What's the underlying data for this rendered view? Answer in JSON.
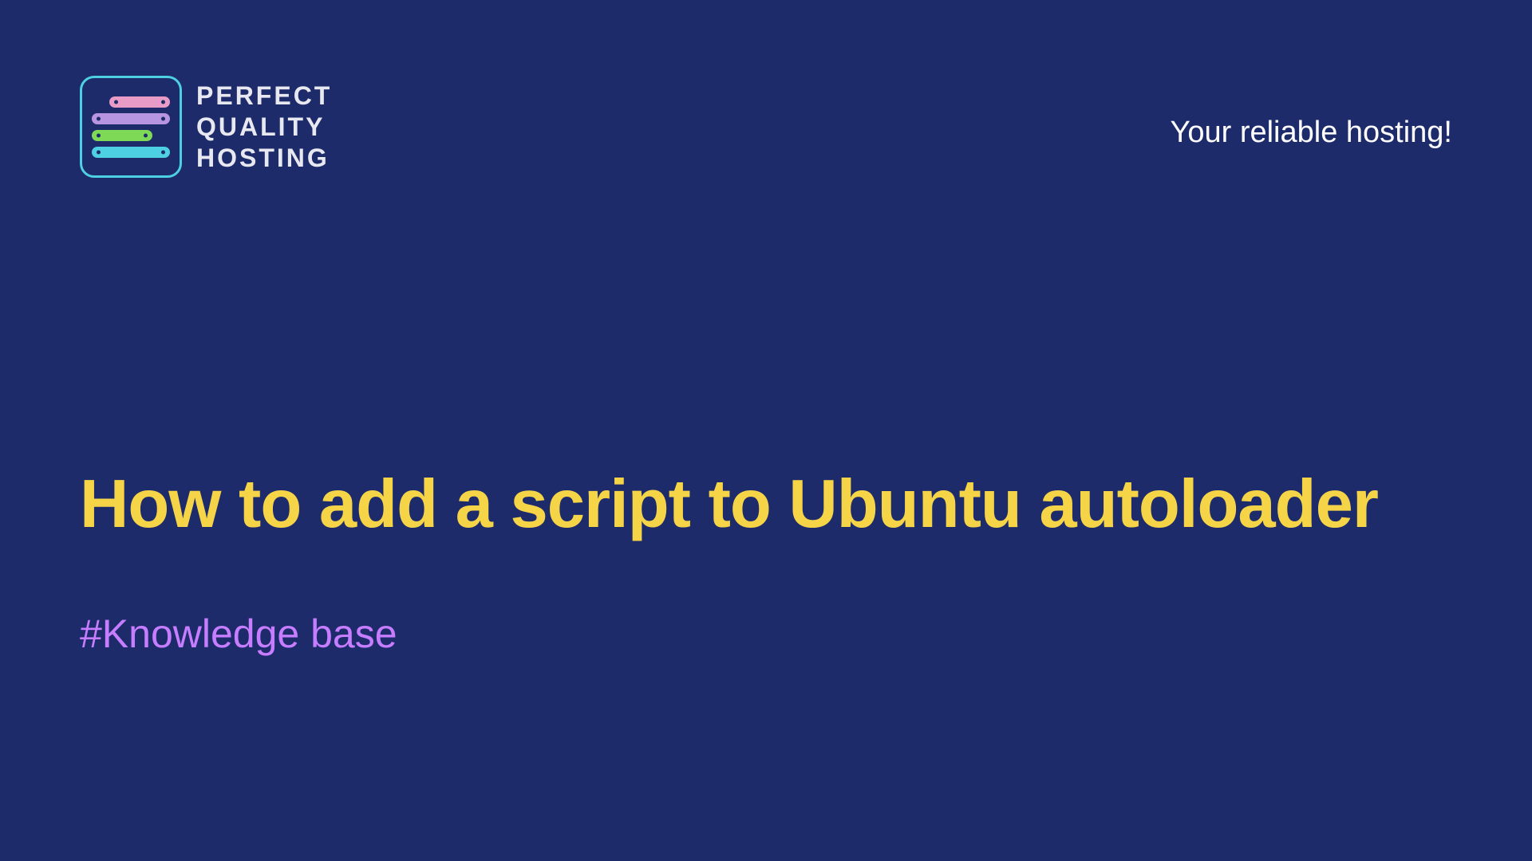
{
  "logo": {
    "line1": "PERFECT",
    "line2": "QUALITY",
    "line3": "HOSTING"
  },
  "tagline": "Your reliable hosting!",
  "title": "How to add a script to Ubuntu autoloader",
  "category": "#Knowledge base"
}
